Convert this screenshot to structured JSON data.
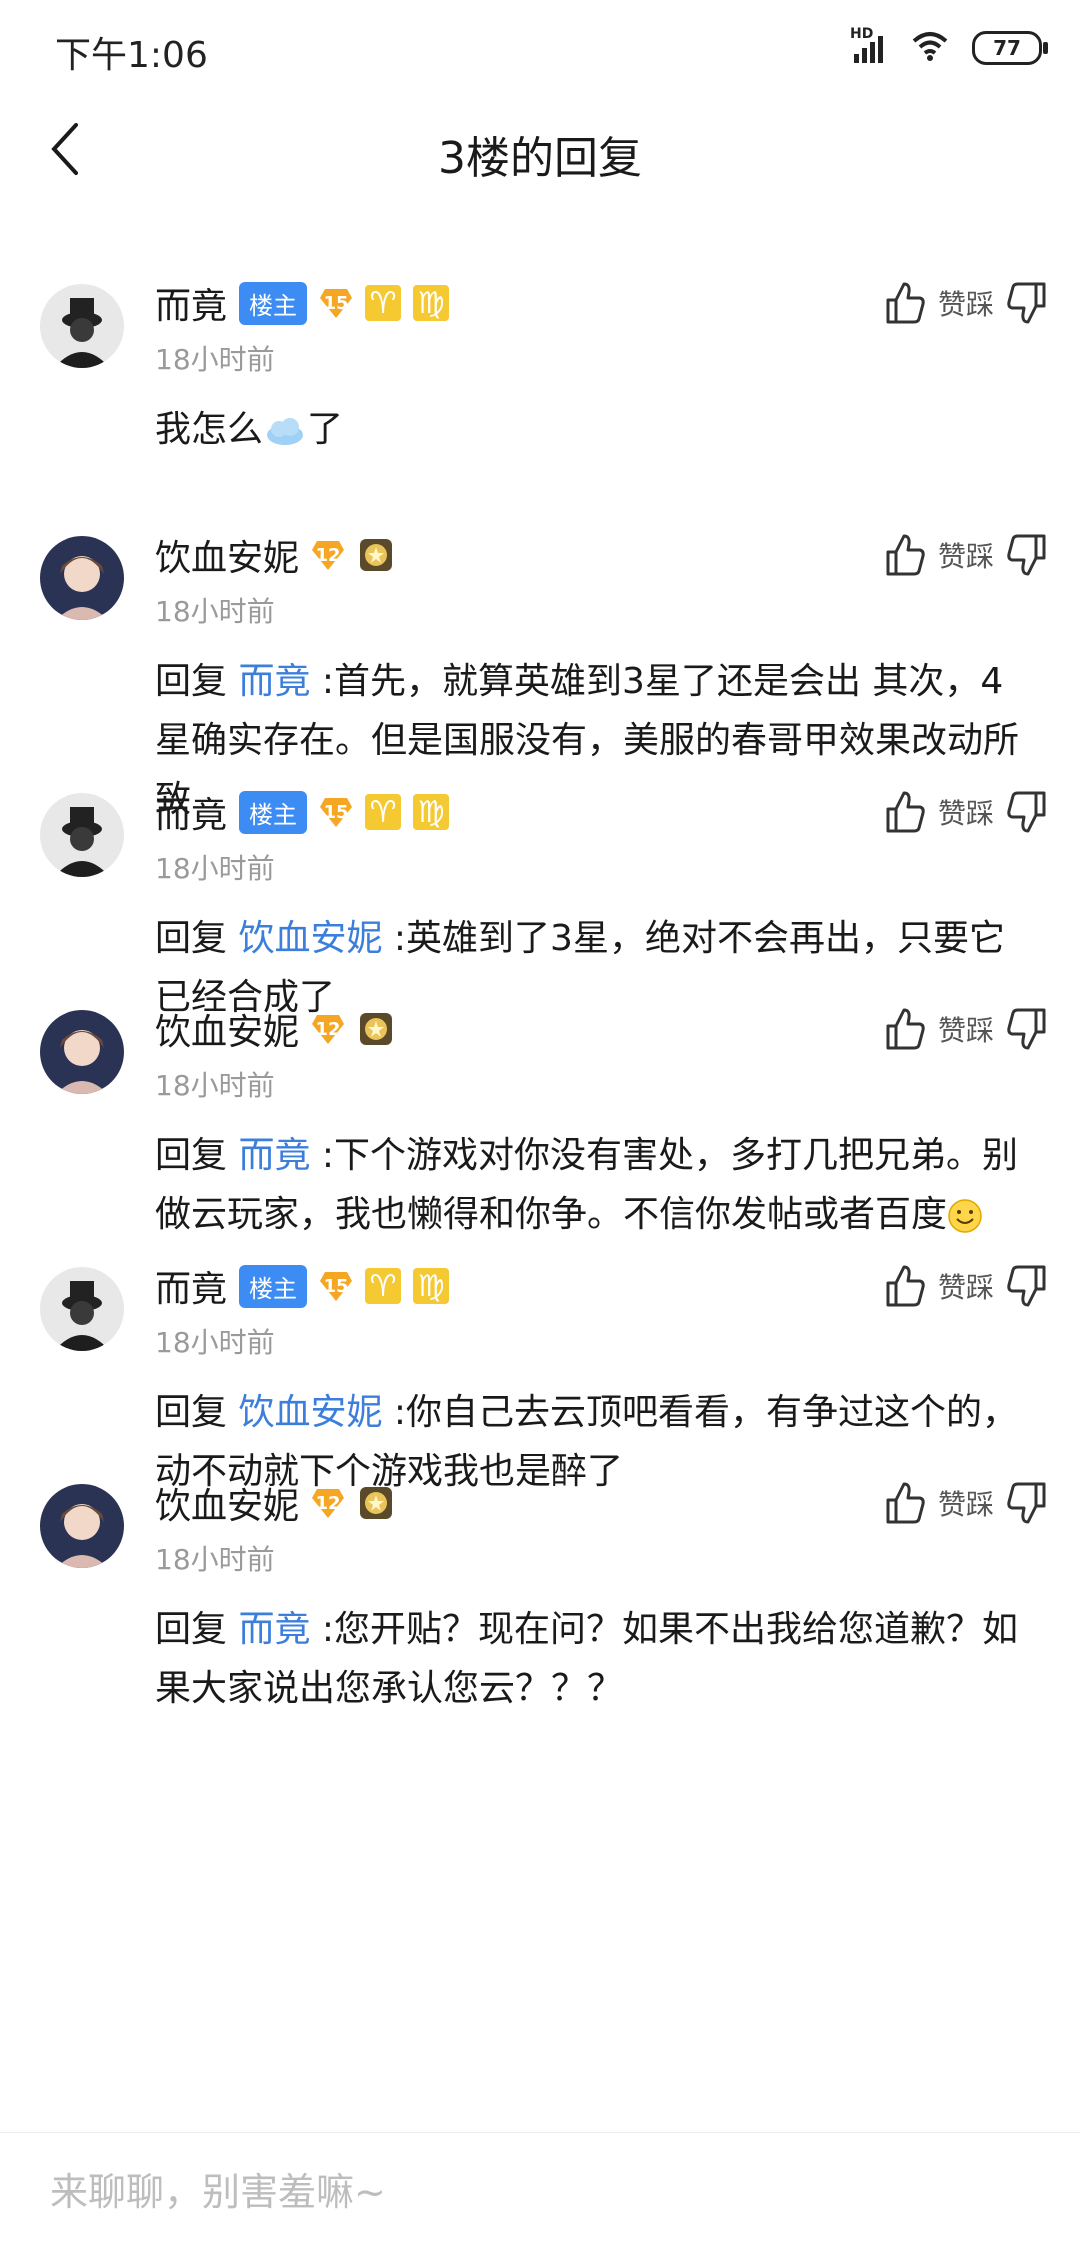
{
  "status": {
    "time": "下午1:06",
    "network": "HD",
    "battery": "77"
  },
  "header": {
    "title": "3楼的回复"
  },
  "actions_label": "赞踩",
  "comments": [
    {
      "user": "而竟",
      "owner_badge": "楼主",
      "level": "15",
      "zodiac": [
        "♈",
        "♍"
      ],
      "time": "18小时前",
      "text_before": "我怎么",
      "text_after": "了"
    },
    {
      "user": "饮血安妮",
      "level": "12",
      "time": "18小时前",
      "reply_word": "回复",
      "reply_to": "而竟",
      "text": " :首先，就算英雄到3星了还是会出 其次，4星确实存在。但是国服没有，美服的春哥甲效果改动所致"
    },
    {
      "user": "而竟",
      "owner_badge": "楼主",
      "level": "15",
      "zodiac": [
        "♈",
        "♍"
      ],
      "time": "18小时前",
      "reply_word": "回复",
      "reply_to": "饮血安妮",
      "text": " :英雄到了3星，绝对不会再出，只要它已经合成了"
    },
    {
      "user": "饮血安妮",
      "level": "12",
      "time": "18小时前",
      "reply_word": "回复",
      "reply_to": "而竟",
      "text": " :下个游戏对你没有害处，多打几把兄弟。别做云玩家，我也懒得和你争。不信你发帖或者百度"
    },
    {
      "user": "而竟",
      "owner_badge": "楼主",
      "level": "15",
      "zodiac": [
        "♈",
        "♍"
      ],
      "time": "18小时前",
      "reply_word": "回复",
      "reply_to": "饮血安妮",
      "text": " :你自己去云顶吧看看，有争过这个的，动不动就下个游戏我也是醉了"
    },
    {
      "user": "饮血安妮",
      "level": "12",
      "time": "18小时前",
      "reply_word": "回复",
      "reply_to": "而竟",
      "text": " :您开贴？现在问？如果不出我给您道歉？如果大家说出您承认您云？？？"
    }
  ],
  "input": {
    "placeholder": "来聊聊，别害羞嘛~"
  },
  "colors": {
    "accent": "#3c7fdb",
    "owner_badge": "#3c8cf3",
    "level_badge": "#f5a623",
    "zodiac": "#f5c932"
  }
}
